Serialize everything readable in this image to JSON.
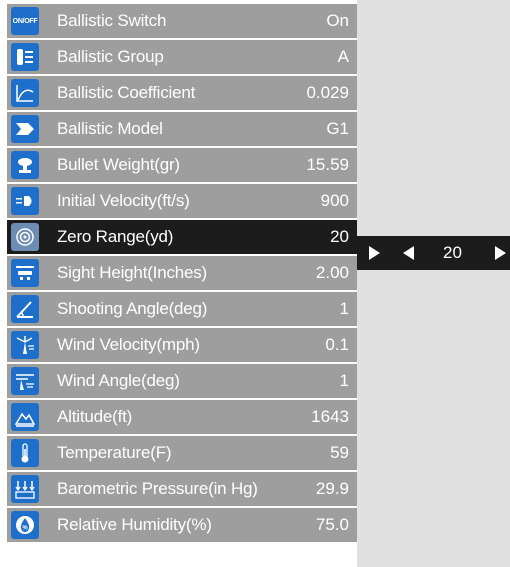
{
  "rows": [
    {
      "icon": "on-off-icon",
      "label": "Ballistic Switch",
      "value": "On"
    },
    {
      "icon": "ballistic-group-icon",
      "label": "Ballistic Group",
      "value": "A"
    },
    {
      "icon": "ballistic-coefficient-icon",
      "label": "Ballistic Coefficient",
      "value": "0.029"
    },
    {
      "icon": "ballistic-model-icon",
      "label": "Ballistic Model",
      "value": "G1"
    },
    {
      "icon": "bullet-weight-icon",
      "label": "Bullet Weight(gr)",
      "value": "15.59"
    },
    {
      "icon": "initial-velocity-icon",
      "label": "Initial Velocity(ft/s)",
      "value": "900"
    },
    {
      "icon": "zero-range-icon",
      "label": "Zero Range(yd)",
      "value": "20"
    },
    {
      "icon": "sight-height-icon",
      "label": "Sight Height(Inches)",
      "value": "2.00"
    },
    {
      "icon": "shooting-angle-icon",
      "label": "Shooting Angle(deg)",
      "value": "1"
    },
    {
      "icon": "wind-velocity-icon",
      "label": "Wind Velocity(mph)",
      "value": "0.1"
    },
    {
      "icon": "wind-angle-icon",
      "label": "Wind Angle(deg)",
      "value": "1"
    },
    {
      "icon": "altitude-icon",
      "label": "Altitude(ft)",
      "value": "1643"
    },
    {
      "icon": "temperature-icon",
      "label": "Temperature(F)",
      "value": "59"
    },
    {
      "icon": "barometric-pressure-icon",
      "label": "Barometric Pressure(in Hg)",
      "value": "29.9"
    },
    {
      "icon": "relative-humidity-icon",
      "label": "Relative Humidity(%)",
      "value": "75.0"
    }
  ],
  "icon_texts": {
    "on_off": "ON/OFF"
  },
  "active_row": "Zero Range(yd)",
  "editor": {
    "value": "20"
  },
  "colors": {
    "row_bg": "#9e9e9e",
    "active_bg": "#1c1c1c",
    "icon_bg": "#1e6fc9",
    "panel_bg": "#e0e0e0"
  }
}
